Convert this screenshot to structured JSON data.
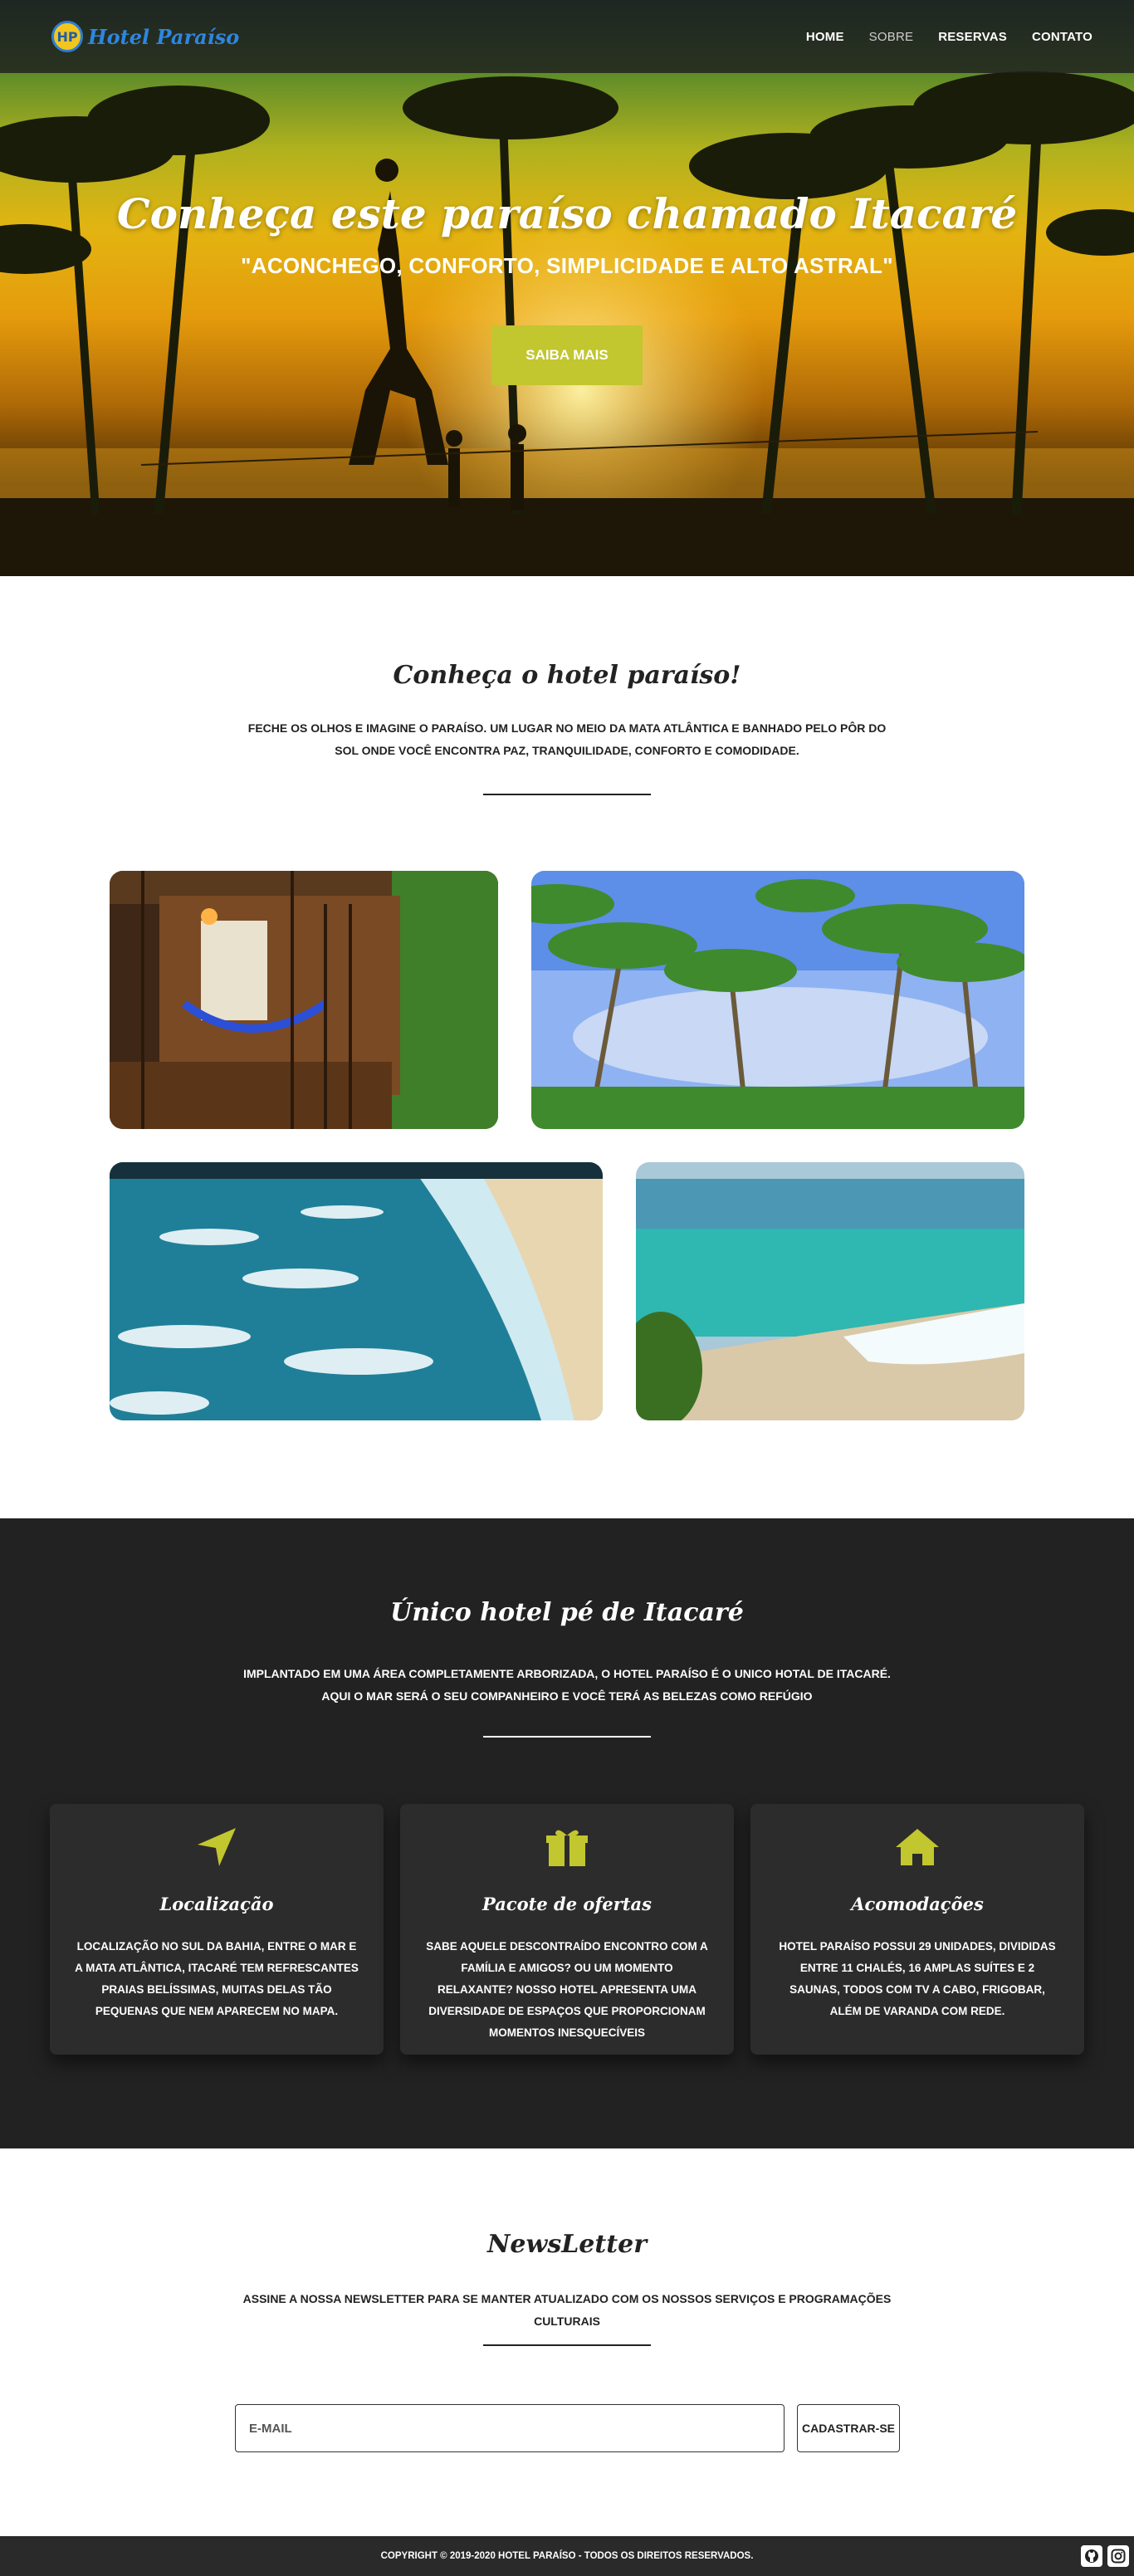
{
  "brand": {
    "logo_mark": "HP",
    "name": "Hotel Paraíso"
  },
  "nav": {
    "items": [
      "Home",
      "Sobre",
      "Reservas",
      "Contato"
    ]
  },
  "hero": {
    "title": "Conheça este paraíso chamado Itacaré",
    "subtitle": "\"ACONCHEGO, CONFORTO, SIMPLICIDADE E ALTO ASTRAL\"",
    "button_label": "SAIBA MAIS"
  },
  "about": {
    "title": "Conheça o hotel paraíso!",
    "text": "Feche os olhos e imagine o paraíso. Um lugar no meio da mata atlântica e banhado pelo pôr do sol onde você encontra paz, tranquilidade, conforto e comodidade."
  },
  "features": {
    "title": "Único hotel pé de Itacaré",
    "text": "Implantado em uma área completamente arborizada, o Hotel Paraíso é o unico hotal de Itacaré. Aqui o mar será o seu companheiro e você terá as belezas como refúgio",
    "cards": [
      {
        "icon": "location-arrow-icon",
        "title": "Localização",
        "text": "Localização no sul da Bahia, entre o mar e a Mata Atlântica, Itacaré tem refrescantes praias belíssimas, muitas delas tão pequenas que nem aparecem no mapa."
      },
      {
        "icon": "gift-icon",
        "title": "Pacote de ofertas",
        "text": "Sabe aquele descontraído encontro com a família e amigos? Ou um momento relaxante? Nosso hotel apresenta uma diversidade de espaços que proporcionam momentos inesquecíveis"
      },
      {
        "icon": "home-icon",
        "title": "Acomodações",
        "text": "Hotel Paraíso possui 29 unidades, divididas entre 11 chalés, 16 amplas suítes e 2 saunas, todos com TV a cabo, frigobar, além de varanda com rede."
      }
    ]
  },
  "newsletter": {
    "title": "NewsLetter",
    "text": "Assine a nossa newsletter para se manter atualizado com os nossos serviços e programações culturais",
    "input_placeholder": "E-MAIL",
    "button_label": "Cadastrar-se"
  },
  "footer": {
    "copyright": "Copyright © 2019-2020 Hotel Paraíso - Todos os direitos reservados.",
    "social_icons": [
      "github-icon",
      "instagram-icon"
    ]
  },
  "colors": {
    "accent": "#c2c62f",
    "dark": "#222222",
    "brand_blue": "#2e86de"
  }
}
